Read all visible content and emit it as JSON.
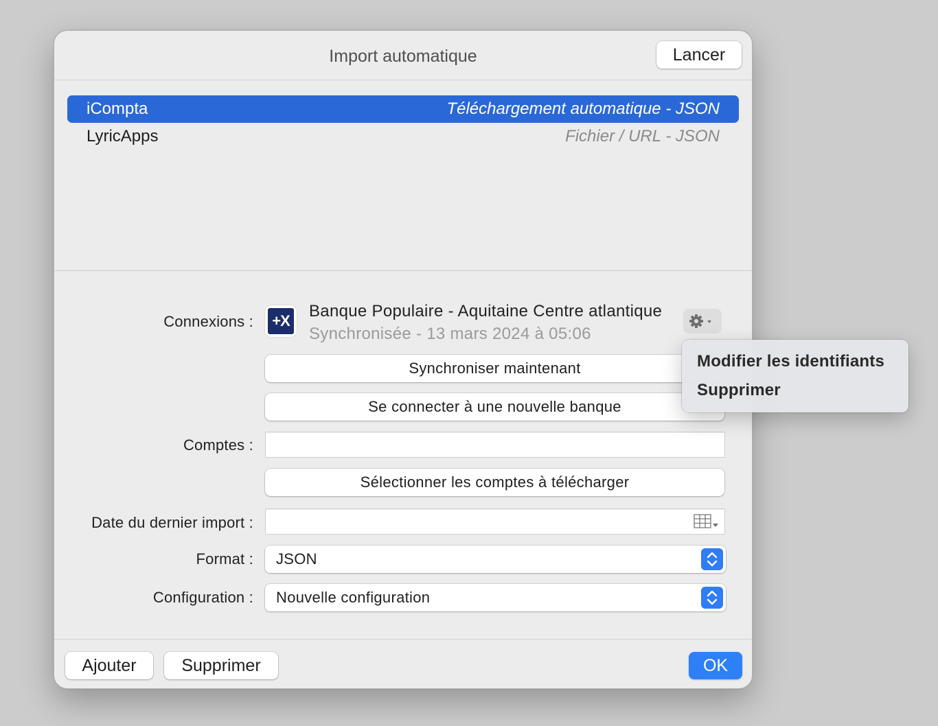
{
  "window": {
    "title": "Import automatique",
    "run_label": "Lancer"
  },
  "sources": [
    {
      "name": "iCompta",
      "type": "Téléchargement automatique - JSON",
      "selected": true
    },
    {
      "name": "LyricApps",
      "type": "Fichier / URL - JSON",
      "selected": false
    }
  ],
  "form": {
    "connections_label": "Connexions :",
    "bank": {
      "logo_text": "+X",
      "name": "Banque Populaire - Aquitaine Centre atlantique",
      "status": "Synchronisée - 13 mars 2024 à 05:06"
    },
    "sync_now_label": "Synchroniser maintenant",
    "connect_new_label": "Se connecter à une nouvelle banque",
    "accounts_label": "Comptes :",
    "accounts_value": "",
    "select_accounts_label": "Sélectionner les comptes à télécharger",
    "last_import_label": "Date du dernier import :",
    "last_import_value": "",
    "format_label": "Format :",
    "format_value": "JSON",
    "config_label": "Configuration :",
    "config_value": "Nouvelle configuration"
  },
  "context_menu": {
    "items": [
      {
        "label": "Modifier les identifiants"
      },
      {
        "label": "Supprimer"
      }
    ]
  },
  "footer": {
    "add_label": "Ajouter",
    "delete_label": "Supprimer",
    "ok_label": "OK"
  },
  "colors": {
    "accent": "#2a68d8",
    "ok_button": "#2f80f7",
    "bank_logo": "#1b2d6c"
  }
}
